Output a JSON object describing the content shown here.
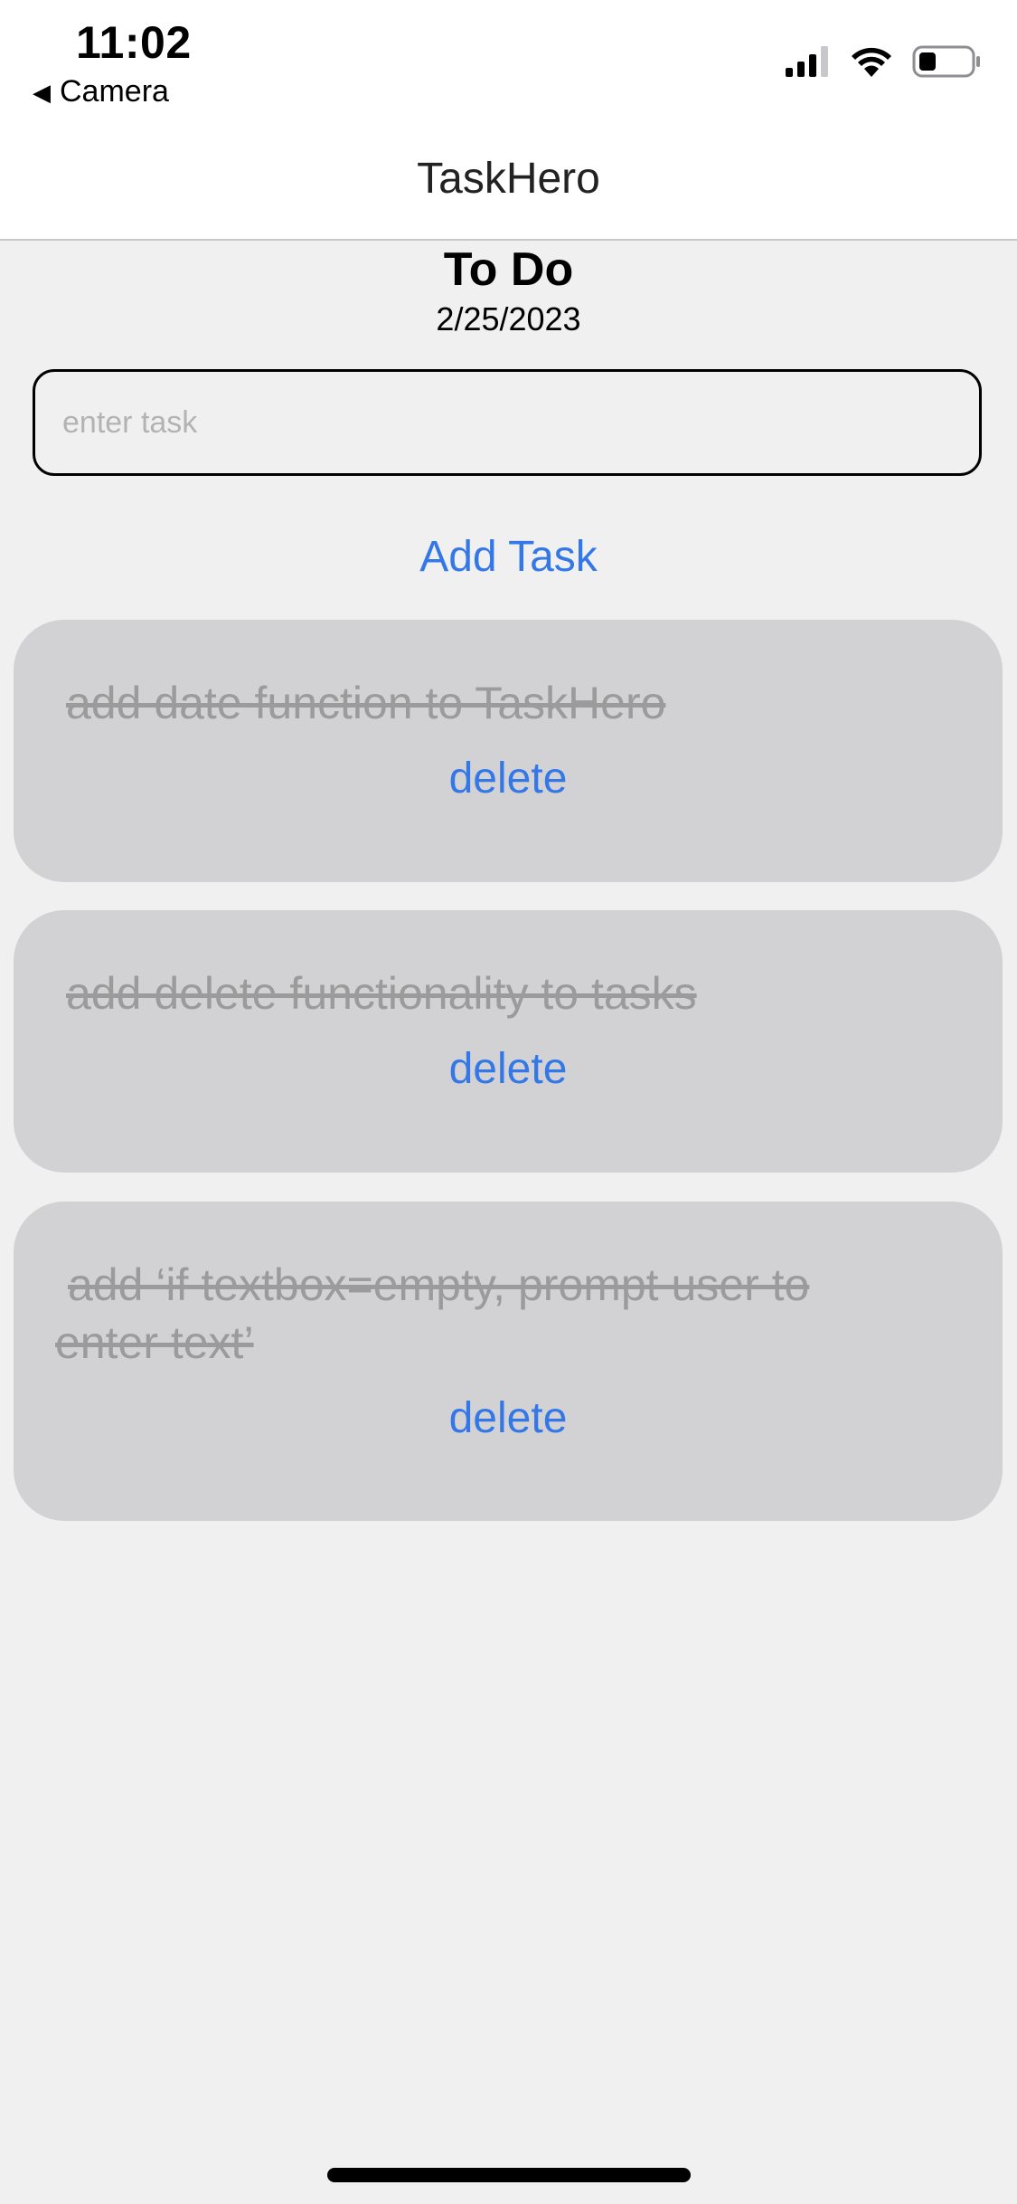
{
  "status_bar": {
    "time": "11:02",
    "back_label": "Camera",
    "back_icon": "back-triangle-icon",
    "icons": [
      "cellular-signal-icon",
      "wifi-icon",
      "battery-icon"
    ]
  },
  "nav": {
    "title": "TaskHero"
  },
  "main": {
    "heading": "To Do",
    "date": "2/25/2023",
    "input_placeholder": "enter task",
    "input_value": "",
    "add_button_label": "Add Task"
  },
  "tasks": [
    {
      "text": "add date function to TaskHero",
      "completed": true,
      "delete_label": "delete"
    },
    {
      "text": "add delete functionality to tasks",
      "completed": true,
      "delete_label": "delete"
    },
    {
      "text": "add ‘if textbox=empty, prompt user to enter text’",
      "completed": true,
      "delete_label": "delete"
    }
  ],
  "colors": {
    "accent": "#3478e8",
    "background": "#f0f0f0",
    "card": "#d2d2d5",
    "completed_text": "#9b9b9b"
  }
}
